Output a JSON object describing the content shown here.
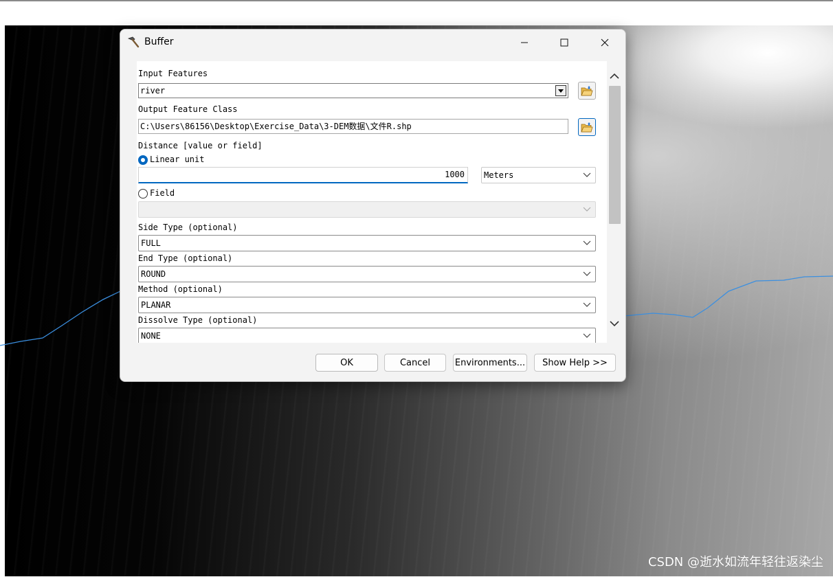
{
  "dialog": {
    "title": "Buffer",
    "title_icon": "hammer-icon",
    "window_controls": [
      "minimize-icon",
      "maximize-icon",
      "close-icon"
    ]
  },
  "form": {
    "input_features": {
      "label": "Input Features",
      "value": "river"
    },
    "output_feature_class": {
      "label": "Output Feature Class",
      "value": "C:\\Users\\86156\\Desktop\\Exercise_Data\\3-DEM数据\\文件R.shp"
    },
    "distance": {
      "label": "Distance [value or field]",
      "linear_unit_label": "Linear unit",
      "linear_unit_selected": true,
      "value": "1000",
      "unit": "Meters",
      "field_label": "Field",
      "field_value": ""
    },
    "side_type": {
      "label": "Side Type (optional)",
      "value": "FULL"
    },
    "end_type": {
      "label": "End Type (optional)",
      "value": "ROUND"
    },
    "method": {
      "label": "Method (optional)",
      "value": "PLANAR"
    },
    "dissolve_type": {
      "label": "Dissolve Type (optional)",
      "value": "NONE"
    }
  },
  "buttons": {
    "ok": "OK",
    "cancel": "Cancel",
    "environments": "Environments...",
    "show_help": "Show Help >>"
  },
  "watermark": "CSDN @逝水如流年轻往返染尘",
  "colors": {
    "accent": "#0067c0",
    "river_line": "#3b8fe0"
  }
}
